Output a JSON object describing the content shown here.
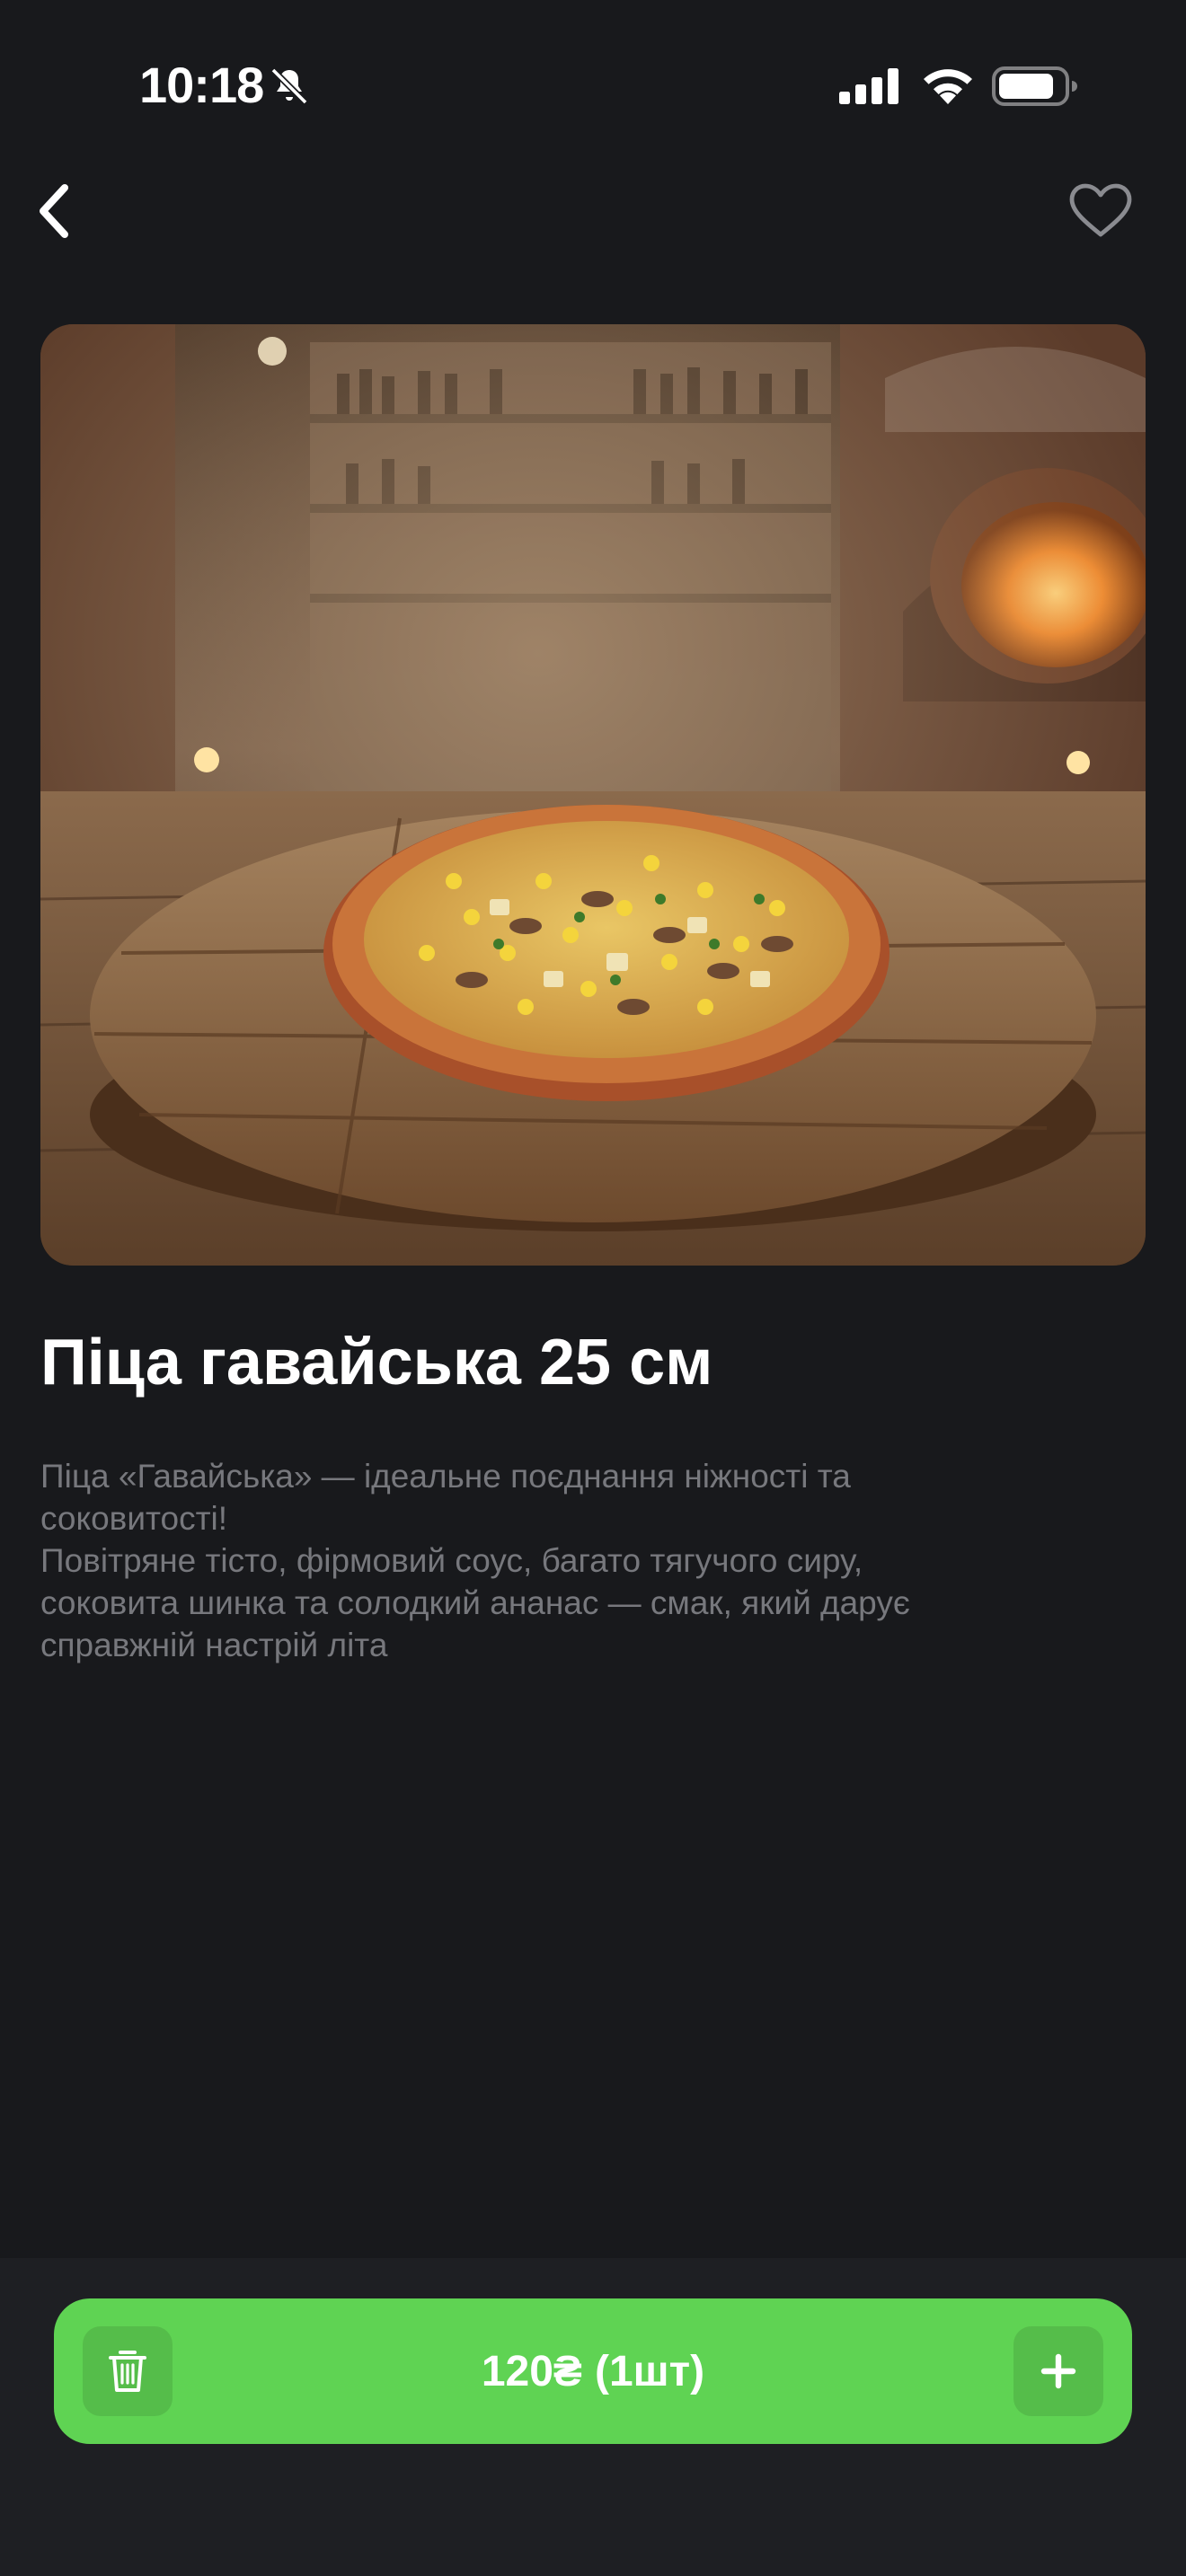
{
  "status_bar": {
    "time": "10:18",
    "icons": [
      "bell-off-icon",
      "signal-icon",
      "wifi-icon",
      "battery-icon"
    ]
  },
  "nav": {
    "back_icon": "chevron-left-icon",
    "favorite_icon": "heart-outline-icon"
  },
  "product": {
    "image_alt": "pizza on wooden board",
    "title": "Піца гавайська 25 см",
    "description": "Піца «Гавайська» — ідеальне поєднання ніжності та\nсоковитості!\nПовітряне тісто, фірмовий соус, багато тягучого сиру,\nсоковита шинка та солодкий ананас — смак, який дарує\nсправжній настрій літа"
  },
  "cart": {
    "price": "120₴",
    "quantity": "(1шт)",
    "trash_icon": "trash-icon",
    "plus_icon": "plus-icon"
  },
  "colors": {
    "background": "#18191c",
    "accent": "#5fd353",
    "text_primary": "#ffffff",
    "text_secondary": "#77787d"
  }
}
